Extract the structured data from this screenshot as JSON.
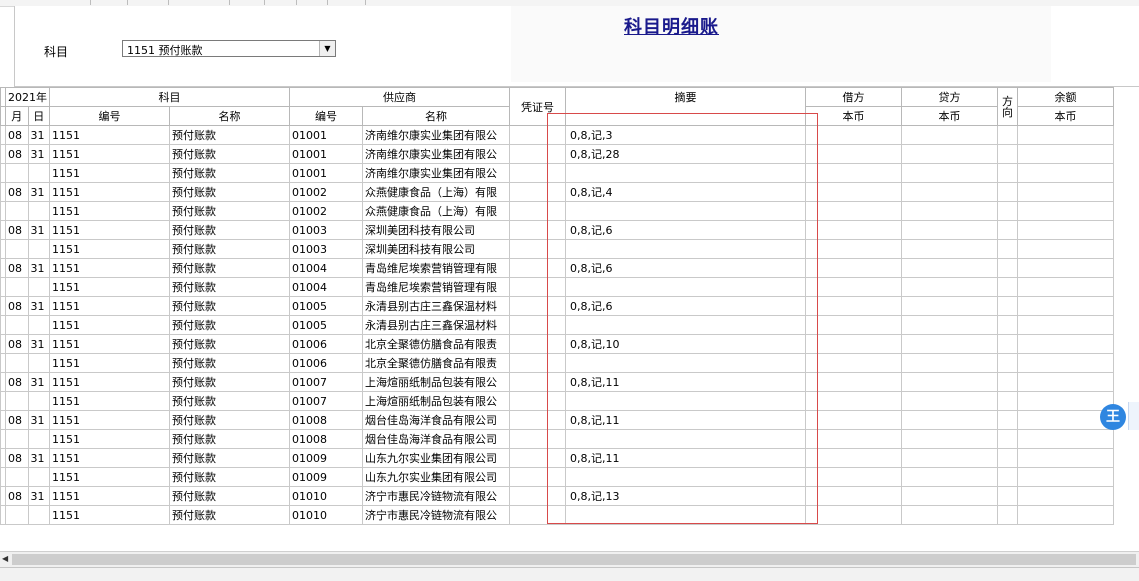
{
  "report": {
    "title": "科目明细账"
  },
  "filter": {
    "subject_label": "科目",
    "subject_value": "1151 预付账款"
  },
  "columns": {
    "year": "2021年",
    "month": "月",
    "day": "日",
    "subject": "科目",
    "supplier": "供应商",
    "code": "编号",
    "name": "名称",
    "voucher": "凭证号",
    "summary": "摘要",
    "debit": "借方",
    "credit": "贷方",
    "direction": "方向",
    "balance": "余额",
    "currency": "本币"
  },
  "rows": [
    [
      "08",
      "31",
      "1151",
      "预付账款",
      "01001",
      "济南维尔康实业集团有限公",
      "",
      "0,8,记,3"
    ],
    [
      "08",
      "31",
      "1151",
      "预付账款",
      "01001",
      "济南维尔康实业集团有限公",
      "",
      "0,8,记,28"
    ],
    [
      "",
      "",
      "1151",
      "预付账款",
      "01001",
      "济南维尔康实业集团有限公",
      "",
      ""
    ],
    [
      "08",
      "31",
      "1151",
      "预付账款",
      "01002",
      "众燕健康食品（上海）有限",
      "",
      "0,8,记,4"
    ],
    [
      "",
      "",
      "1151",
      "预付账款",
      "01002",
      "众燕健康食品（上海）有限",
      "",
      ""
    ],
    [
      "08",
      "31",
      "1151",
      "预付账款",
      "01003",
      "深圳美团科技有限公司",
      "",
      "0,8,记,6"
    ],
    [
      "",
      "",
      "1151",
      "预付账款",
      "01003",
      "深圳美团科技有限公司",
      "",
      ""
    ],
    [
      "08",
      "31",
      "1151",
      "预付账款",
      "01004",
      "青岛维尼埃索营销管理有限",
      "",
      "0,8,记,6"
    ],
    [
      "",
      "",
      "1151",
      "预付账款",
      "01004",
      "青岛维尼埃索营销管理有限",
      "",
      ""
    ],
    [
      "08",
      "31",
      "1151",
      "预付账款",
      "01005",
      "永清县别古庄三鑫保温材料",
      "",
      "0,8,记,6"
    ],
    [
      "",
      "",
      "1151",
      "预付账款",
      "01005",
      "永清县别古庄三鑫保温材料",
      "",
      ""
    ],
    [
      "08",
      "31",
      "1151",
      "预付账款",
      "01006",
      "北京全聚德仿膳食品有限责",
      "",
      "0,8,记,10"
    ],
    [
      "",
      "",
      "1151",
      "预付账款",
      "01006",
      "北京全聚德仿膳食品有限责",
      "",
      ""
    ],
    [
      "08",
      "31",
      "1151",
      "预付账款",
      "01007",
      "上海煊丽纸制品包装有限公",
      "",
      "0,8,记,11"
    ],
    [
      "",
      "",
      "1151",
      "预付账款",
      "01007",
      "上海煊丽纸制品包装有限公",
      "",
      ""
    ],
    [
      "08",
      "31",
      "1151",
      "预付账款",
      "01008",
      "烟台佳岛海洋食品有限公司",
      "",
      "0,8,记,11"
    ],
    [
      "",
      "",
      "1151",
      "预付账款",
      "01008",
      "烟台佳岛海洋食品有限公司",
      "",
      ""
    ],
    [
      "08",
      "31",
      "1151",
      "预付账款",
      "01009",
      "山东九尔实业集团有限公司",
      "",
      "0,8,记,11"
    ],
    [
      "",
      "",
      "1151",
      "预付账款",
      "01009",
      "山东九尔实业集团有限公司",
      "",
      ""
    ],
    [
      "08",
      "31",
      "1151",
      "预付账款",
      "01010",
      "济宁市惠民冷链物流有限公",
      "",
      "0,8,记,13"
    ],
    [
      "",
      "",
      "1151",
      "预付账款",
      "01010",
      "济宁市惠民冷链物流有限公",
      "",
      ""
    ]
  ],
  "floating_button": {
    "label": "王"
  }
}
